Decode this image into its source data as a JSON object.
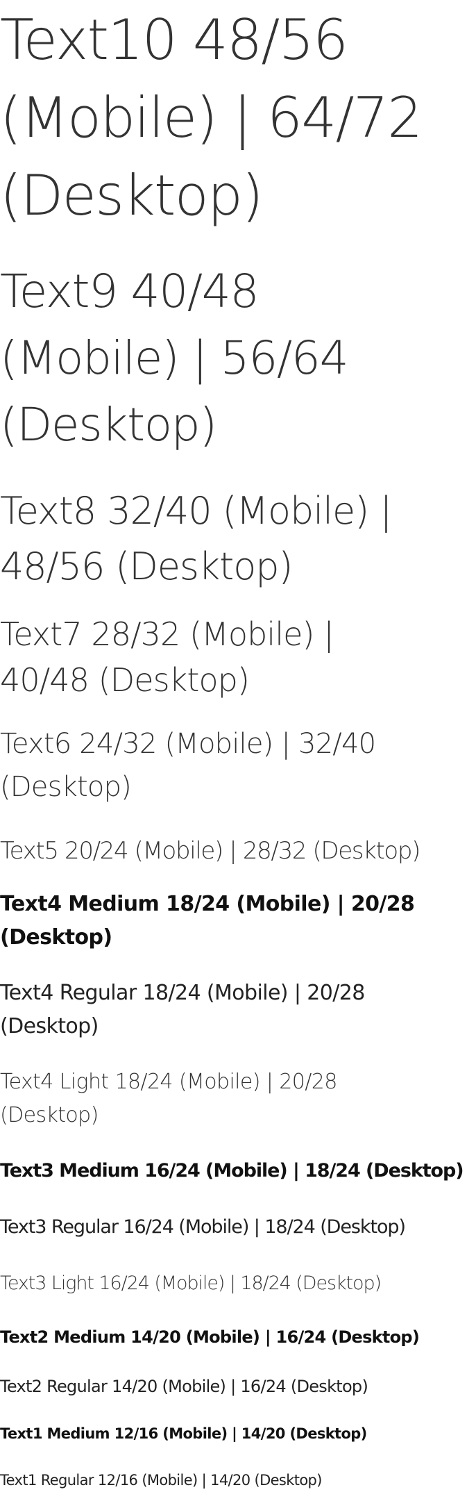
{
  "specimens": {
    "text10": "Text10 48/56 (Mobile) | 64/72 (Desktop)",
    "text9": "Text9 40/48 (Mobile) | 56/64 (Desktop)",
    "text8": "Text8 32/40 (Mobile) | 48/56 (Desktop)",
    "text7": "Text7 28/32 (Mobile) | 40/48 (Desktop)",
    "text6": "Text6 24/32 (Mobile) | 32/40 (Desktop)",
    "text5": "Text5 20/24 (Mobile) | 28/32 (Desktop)",
    "text4_medium": "Text4 Medium 18/24 (Mobile) | 20/28 (Desktop)",
    "text4_regular": "Text4 Regular 18/24 (Mobile) | 20/28 (Desktop)",
    "text4_light": "Text4 Light 18/24 (Mobile) | 20/28 (Desktop)",
    "text3_medium": "Text3 Medium 16/24 (Mobile) | 18/24 (Desktop)",
    "text3_regular": "Text3 Regular 16/24 (Mobile) | 18/24 (Desktop)",
    "text3_light": "Text3 Light 16/24 (Mobile) | 18/24 (Desktop)",
    "text2_medium": "Text2 Medium 14/20 (Mobile) | 16/24 (Desktop)",
    "text2_regular": "Text2 Regular 14/20 (Mobile) | 16/24 (Desktop)",
    "text1_medium": "Text1 Medium 12/16 (Mobile) | 14/20 (Desktop)",
    "text1_regular": "Text1 Regular 12/16 (Mobile) | 14/20 (Desktop)"
  },
  "colors": {
    "background": "#ffffff",
    "text": "#222222"
  }
}
